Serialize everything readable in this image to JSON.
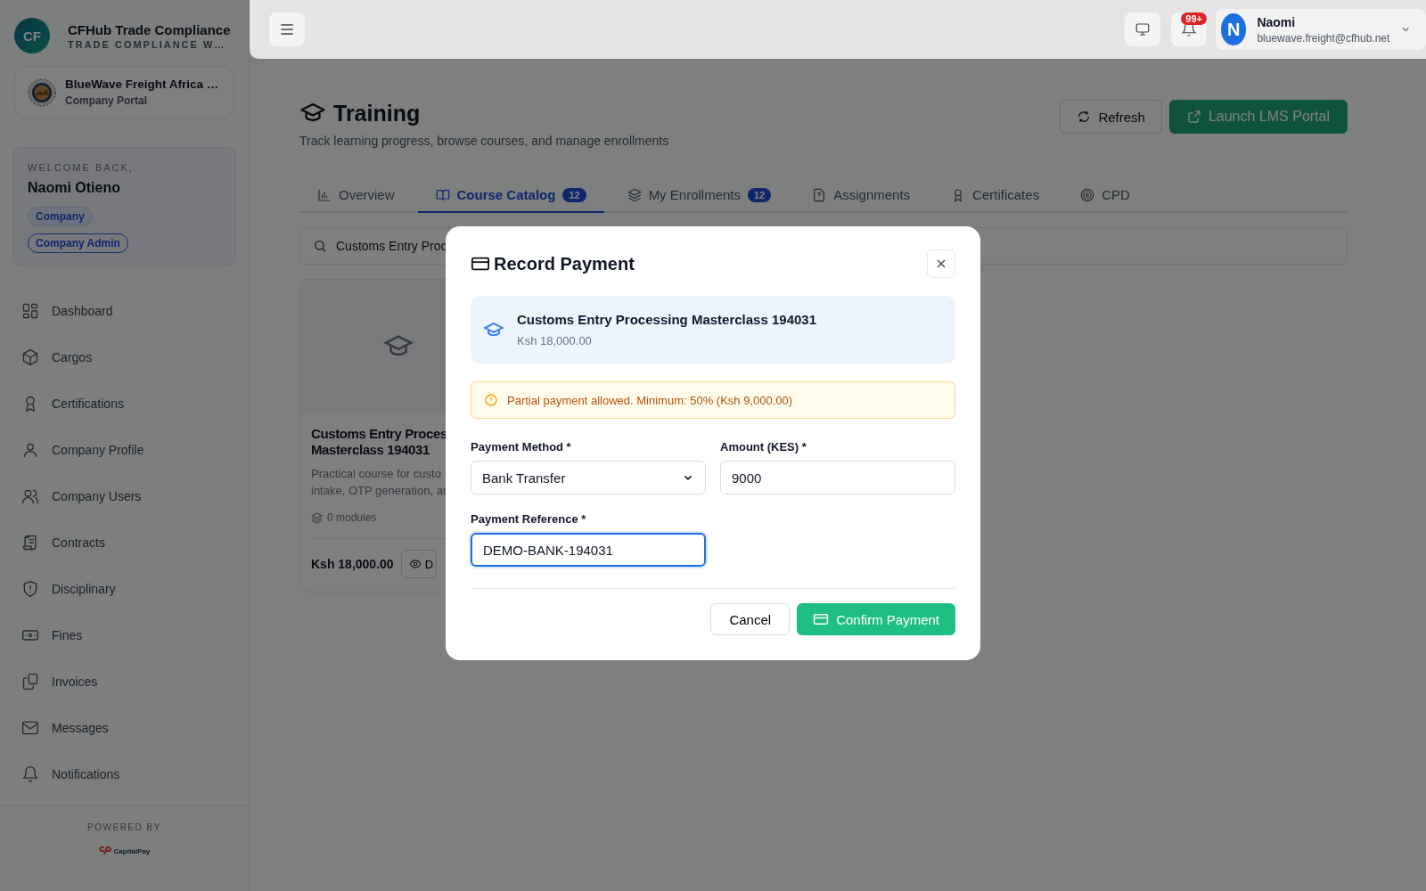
{
  "brand": {
    "logo": "CF",
    "title": "CFHub Trade Compliance",
    "subtitle": "TRADE COMPLIANCE W…"
  },
  "company": {
    "name": "BlueWave Freight Africa …",
    "role": "Company Portal"
  },
  "welcome": {
    "label": "WELCOME BACK,",
    "name": "Naomi Otieno",
    "badges": [
      {
        "label": "Company",
        "kind": "filled"
      },
      {
        "label": "Company Admin",
        "kind": "outline"
      }
    ]
  },
  "nav": [
    {
      "label": "Dashboard"
    },
    {
      "label": "Cargos"
    },
    {
      "label": "Certifications"
    },
    {
      "label": "Company Profile"
    },
    {
      "label": "Company Users"
    },
    {
      "label": "Contracts"
    },
    {
      "label": "Disciplinary"
    },
    {
      "label": "Fines"
    },
    {
      "label": "Invoices"
    },
    {
      "label": "Messages"
    },
    {
      "label": "Notifications"
    }
  ],
  "footer": {
    "label": "POWERED BY",
    "logo": "CapitalPay"
  },
  "topbar": {
    "notifications": "99+",
    "user": {
      "initial": "N",
      "name": "Naomi",
      "email": "bluewave.freight@cfhub.net"
    }
  },
  "page": {
    "title": "Training",
    "subtitle": "Track learning progress, browse courses, and manage enrollments",
    "refresh": "Refresh",
    "launch": "Launch LMS Portal"
  },
  "tabs": [
    {
      "label": "Overview",
      "selected": false
    },
    {
      "label": "Course Catalog",
      "count": "12",
      "selected": true
    },
    {
      "label": "My Enrollments",
      "count": "12",
      "selected": false
    },
    {
      "label": "Assignments",
      "selected": false
    },
    {
      "label": "Certificates",
      "selected": false
    },
    {
      "label": "CPD",
      "selected": false
    }
  ],
  "search": {
    "value": "Customs Entry Proc"
  },
  "course_card": {
    "title_lines": [
      "Customs Entry Proces",
      "Masterclass 194031"
    ],
    "description_lines": [
      "Practical course for custo",
      "intake, OTP generation, ar"
    ],
    "modules": "0 modules",
    "price": "Ksh 18,000.00",
    "button": "D"
  },
  "dialog": {
    "title": "Record Payment",
    "course": "Customs Entry Processing Masterclass 194031",
    "price": "Ksh 18,000.00",
    "alert": "Partial payment allowed. Minimum: 50% (Ksh 9,000.00)",
    "fields": [
      {
        "label": "Payment Method *",
        "kind": "select",
        "value": "Bank Transfer",
        "focused": false
      },
      {
        "label": "Amount (KES) *",
        "kind": "input",
        "value": "9000",
        "focused": false
      },
      {
        "label": "Payment Reference *",
        "kind": "input",
        "value": "DEMO-BANK-194031",
        "focused": true
      }
    ],
    "cancel": "Cancel",
    "confirm": "Confirm Payment"
  }
}
